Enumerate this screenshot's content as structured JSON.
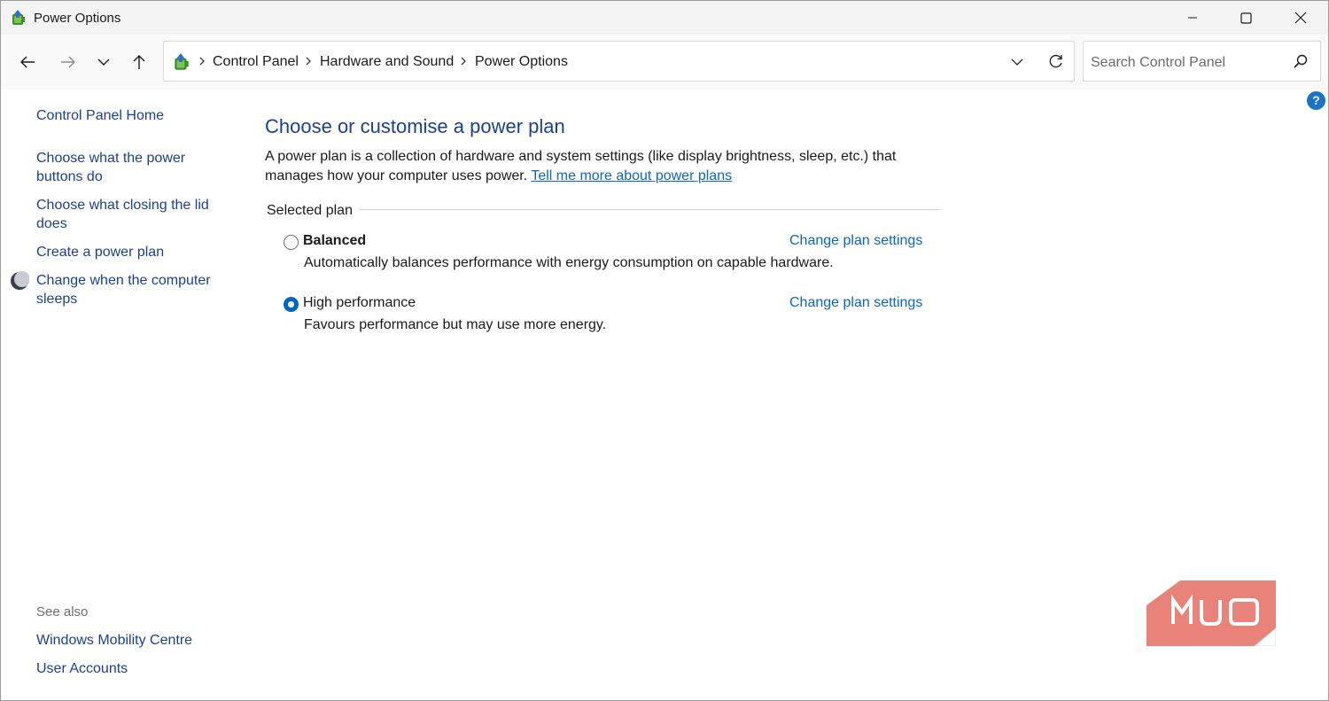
{
  "window": {
    "title": "Power Options",
    "icon": "power-options-icon",
    "controls": [
      "minimize-icon",
      "maximize-icon",
      "close-icon"
    ]
  },
  "nav": {
    "back": "back-arrow-icon",
    "forward": "forward-arrow-icon",
    "recent": "chevron-down-icon",
    "up": "up-arrow-icon"
  },
  "address": {
    "crumbs": [
      "Control Panel",
      "Hardware and Sound",
      "Power Options"
    ]
  },
  "search": {
    "placeholder": "Search Control Panel"
  },
  "help": {
    "label": "?"
  },
  "sidebar": {
    "home": "Control Panel Home",
    "links": [
      "Choose what the power buttons do",
      "Choose what closing the lid does",
      "Create a power plan",
      "Change when the computer sleeps"
    ],
    "see_also_title": "See also",
    "see_also": [
      "Windows Mobility Centre",
      "User Accounts"
    ]
  },
  "main": {
    "heading": "Choose or customise a power plan",
    "description": "A power plan is a collection of hardware and system settings (like display brightness, sleep, etc.) that manages how your computer uses power.",
    "description_link": "Tell me more about power plans",
    "selected_plan_label": "Selected plan",
    "plans": [
      {
        "name": "Balanced",
        "description": "Automatically balances performance with energy consumption on capable hardware.",
        "link": "Change plan settings",
        "selected": false
      },
      {
        "name": "High performance",
        "description": "Favours performance but may use more energy.",
        "link": "Change plan settings",
        "selected": true
      }
    ]
  },
  "watermark": {
    "text": "MUO",
    "color": "#e9837a"
  },
  "colors": {
    "link": "#0a66c2",
    "heading": "#1c3f94",
    "accent": "#0067c0"
  }
}
